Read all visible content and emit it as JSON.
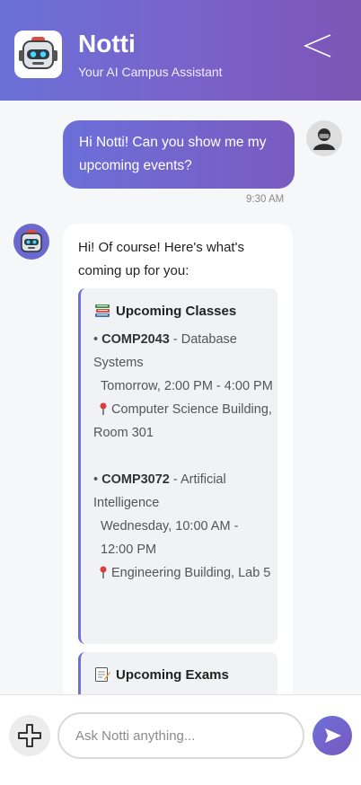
{
  "header": {
    "title": "Notti",
    "subtitle": "Your AI Campus Assistant",
    "logo_icon": "robot-icon",
    "back_icon": "chevron-left-icon",
    "gradient": [
      "#6a71d8",
      "#7d55b5"
    ]
  },
  "messages": {
    "user": {
      "text": "Hi Notti! Can you show me my upcoming events?",
      "time": "9:30 AM",
      "avatar_icon": "user-avatar-icon"
    },
    "bot": {
      "intro": "Hi! Of course! Here's what's coming up for you:",
      "avatar_icon": "robot-icon",
      "classes": {
        "heading": "Upcoming Classes",
        "icon": "books-icon",
        "items": [
          {
            "code": "COMP2043",
            "name": "- Database Systems",
            "time": "Tomorrow, 2:00 PM - 4:00 PM",
            "location": "Computer Science Building, Room 301"
          },
          {
            "code": "COMP3072",
            "name": "- Artificial Intelligence",
            "time": "Wednesday, 10:00 AM - 12:00 PM",
            "location": "Engineering Building, Lab 5"
          }
        ]
      },
      "exams": {
        "heading": "Upcoming Exams",
        "icon": "memo-icon"
      }
    }
  },
  "composer": {
    "placeholder": "Ask Notti anything...",
    "value": "",
    "add_icon": "plus-icon",
    "send_icon": "send-icon"
  },
  "colors": {
    "accent": "#6b72d9",
    "chat_bg": "#f6f7f9"
  }
}
